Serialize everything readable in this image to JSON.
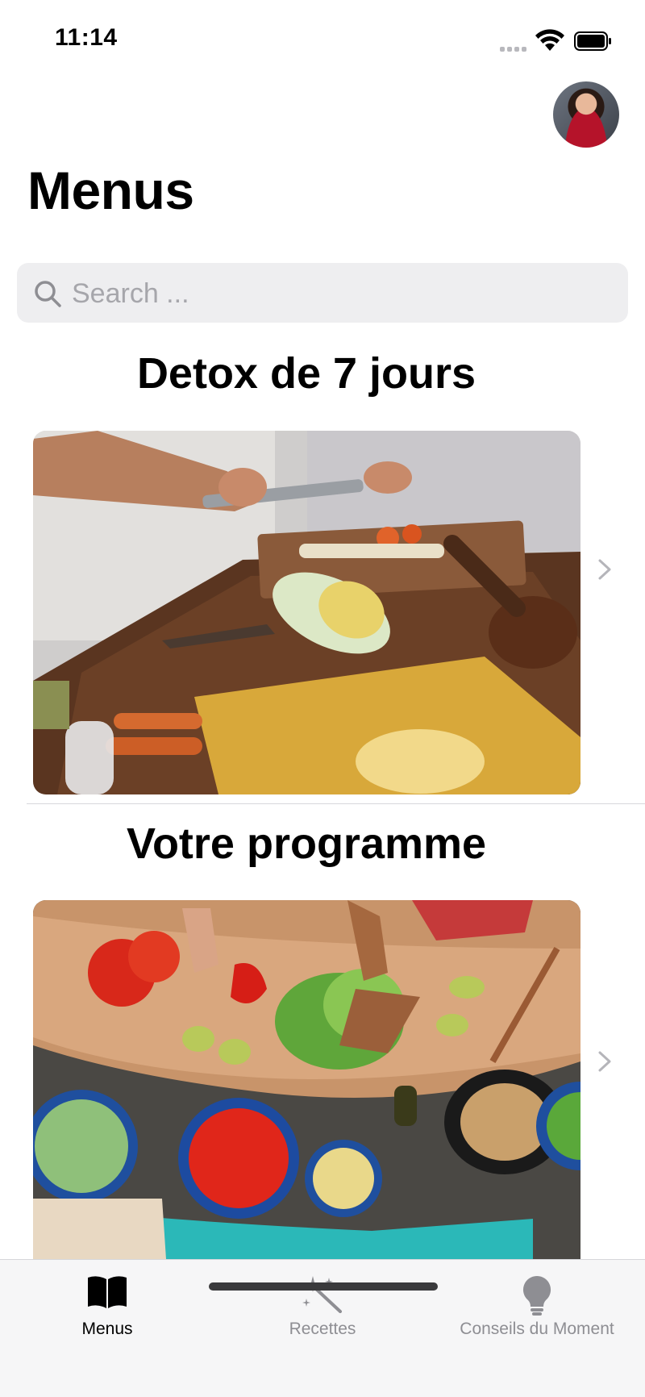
{
  "status_bar": {
    "time": "11:14"
  },
  "header": {
    "title": "Menus"
  },
  "search": {
    "placeholder": "Search ..."
  },
  "sections": [
    {
      "title": "Detox de 7 jours"
    },
    {
      "title": "Votre programme"
    }
  ],
  "tab_bar": {
    "tabs": [
      {
        "label": "Menus",
        "icon": "book-icon",
        "active": true
      },
      {
        "label": "Recettes",
        "icon": "magic-wand-icon",
        "active": false
      },
      {
        "label": "Conseils du Moment",
        "icon": "lightbulb-icon",
        "active": false
      }
    ]
  },
  "colors": {
    "background": "#ffffff",
    "search_bg": "#eeeef0",
    "inactive_tab": "#8e8e93",
    "tab_bar_bg": "#f6f6f7"
  }
}
